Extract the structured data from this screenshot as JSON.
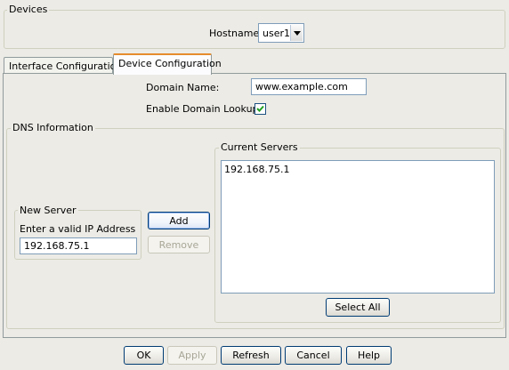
{
  "devices": {
    "legend": "Devices",
    "hostname_label": "Hostname:",
    "hostname_value": "user1"
  },
  "tabs": [
    {
      "label": "Interface Configuration",
      "selected": false
    },
    {
      "label": "Device Configuration",
      "selected": true
    }
  ],
  "device_config": {
    "domain_name_label": "Domain Name:",
    "domain_name_value": "www.example.com",
    "domain_lookup_label": "Enable Domain Lookup:",
    "domain_lookup_checked": true
  },
  "dns": {
    "legend": "DNS Information",
    "new_server": {
      "legend": "New Server",
      "prompt": "Enter a valid IP Address",
      "ip_value": "192.168.75.1"
    },
    "add_label": "Add",
    "remove_label": "Remove",
    "current_servers": {
      "legend": "Current Servers",
      "items": [
        "192.168.75.1"
      ]
    },
    "select_all_label": "Select All"
  },
  "footer": {
    "ok_label": "OK",
    "apply_label": "Apply",
    "refresh_label": "Refresh",
    "cancel_label": "Cancel",
    "help_label": "Help"
  },
  "colors": {
    "background": "#ecebe6",
    "active_tab_accent": "#e68b2c",
    "field_border": "#7f9db9",
    "button_border": "#003c74",
    "check_color": "#21a121"
  }
}
